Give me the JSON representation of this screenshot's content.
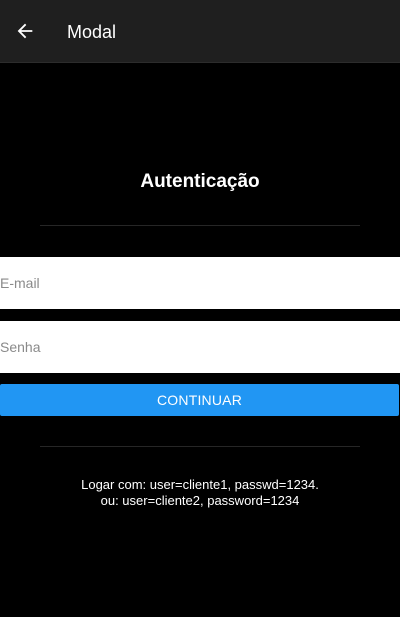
{
  "toolbar": {
    "back_icon": "arrow-left-icon",
    "title": "Modal",
    "background": "#1f1f1f"
  },
  "auth": {
    "heading": "Autenticação",
    "email_placeholder": "E-mail",
    "password_placeholder": "Senha",
    "continue_label": "CONTINUAR",
    "accent": "#2196f3"
  },
  "hint": {
    "line1": "Logar com: user=cliente1, passwd=1234.",
    "line2": "ou: user=cliente2, password=1234"
  }
}
